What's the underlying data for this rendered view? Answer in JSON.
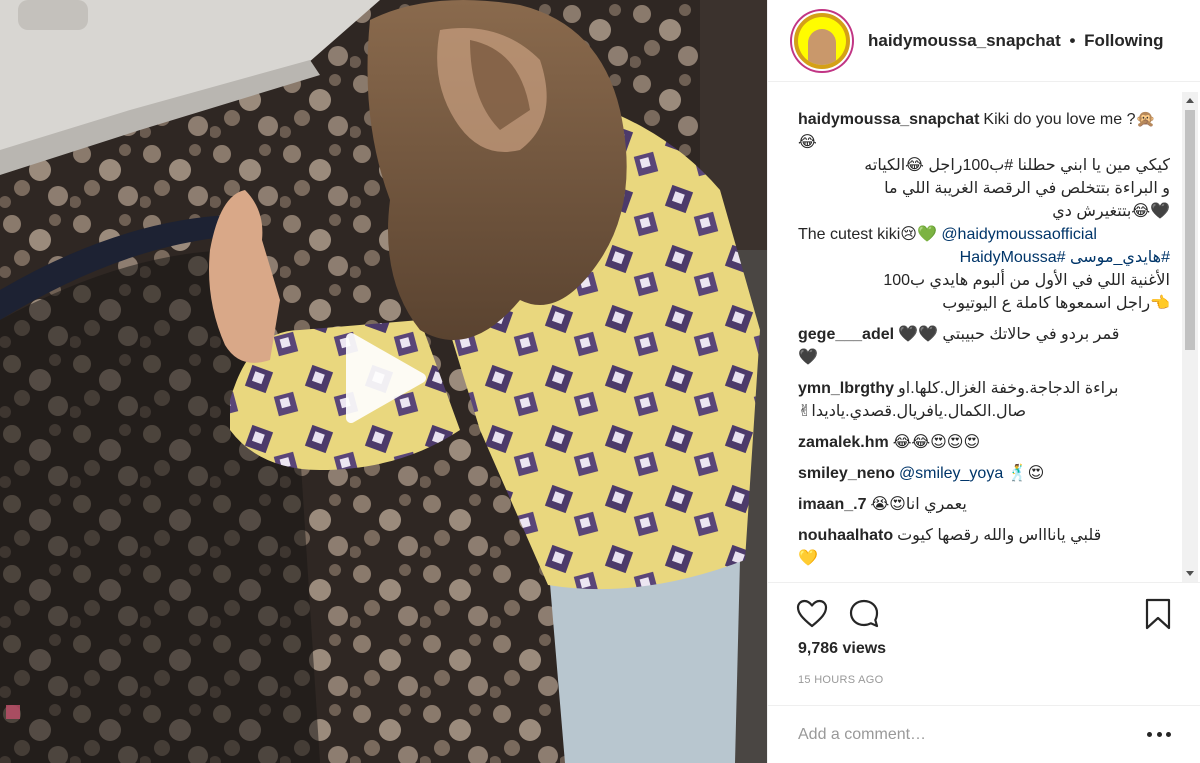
{
  "post": {
    "username": "haidymoussa_snapchat",
    "follow_status": "Following",
    "separator": "•"
  },
  "caption": {
    "username": "haidymoussa_snapchat",
    "line1": "Kiki do you love me ?🙊😂",
    "line2": "كيكي مين يا ابني حطلنا #ب100راجل 😂الكياته",
    "line3": "و البراءة بتتخلص في الرقصة الغريبة اللي ما",
    "line4": "🖤😂بتتغيرش دي",
    "line5_text": "The cutest kiki😢💚 ",
    "line5_mention": "@haidymoussaofficial",
    "line6": "#هايدي_موسى #HaidyMoussa",
    "line7": "الأغنية اللي في الأول من ألبوم هايدي ب100",
    "line8": "👈راجل اسمعوها كاملة ع اليوتيوب"
  },
  "comments": [
    {
      "user": "gege___adel",
      "text": "🖤🖤 قمر بردو في حالاتك حبيبتي",
      "text2": "🖤"
    },
    {
      "user": "ymn_lbrgthy",
      "text": "براءة الدجاجة.وخفة الغزال.كلها.او",
      "text2": "✌صال.الكمال.يافريال.قصدي.ياديدا"
    },
    {
      "user": "zamalek.hm",
      "text": "😂😂😍😍😍"
    },
    {
      "user": "smiley_neno",
      "mention": "@smiley_yoya",
      "text": " 🕺😍"
    },
    {
      "user": "imaan_.7",
      "text": "😭😍يعمري انا"
    },
    {
      "user": "nouhaalhato",
      "text": "قلبي ياناااس والله رقصها كيوت",
      "text2": "💛"
    }
  ],
  "stats": {
    "views": "9,786 views",
    "time_ago": "15 HOURS AGO"
  },
  "add_comment": {
    "placeholder": "Add a comment…"
  },
  "icons": {
    "like": "heart-icon",
    "comment": "comment-bubble-icon",
    "save": "bookmark-icon",
    "play": "play-icon",
    "more": "more-options-icon"
  }
}
